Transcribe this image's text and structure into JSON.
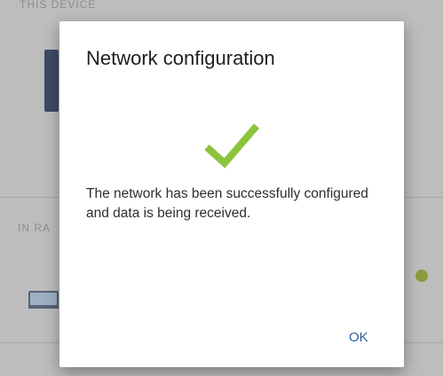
{
  "background": {
    "header_label": "THIS DEVICE",
    "section_label": "IN RA"
  },
  "dialog": {
    "title": "Network configuration",
    "status_icon": "check-icon",
    "status_color": "#8cc43c",
    "message": "The network has been successfully configured and data is being received.",
    "ok_label": "OK"
  },
  "colors": {
    "accent": "#2e5c9b",
    "scrim": "#bdbdbd"
  }
}
